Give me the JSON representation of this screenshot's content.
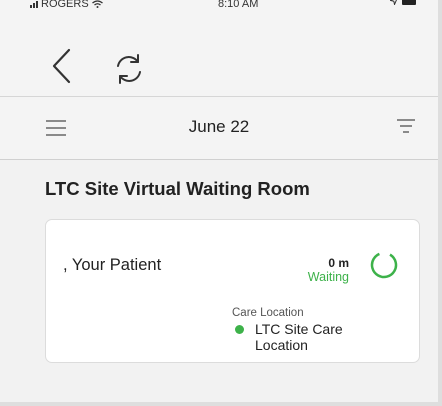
{
  "status_bar": {
    "carrier": "ROGERS",
    "time": "8:10 AM"
  },
  "toolbar": {
    "back_icon": "chevron-left-icon",
    "refresh_icon": "refresh-icon"
  },
  "header": {
    "menu_icon": "hamburger-menu-icon",
    "date": "June 22",
    "filter_icon": "filter-icon"
  },
  "room": {
    "title": "LTC Site Virtual Waiting Room"
  },
  "patient_card": {
    "name": ", Your Patient",
    "wait_time": "0 m",
    "status": "Waiting",
    "location_label": "Care Location",
    "location_name": "LTC Site Care Location"
  },
  "colors": {
    "accent_green": "#3db24a",
    "background": "#f2f2f2"
  }
}
